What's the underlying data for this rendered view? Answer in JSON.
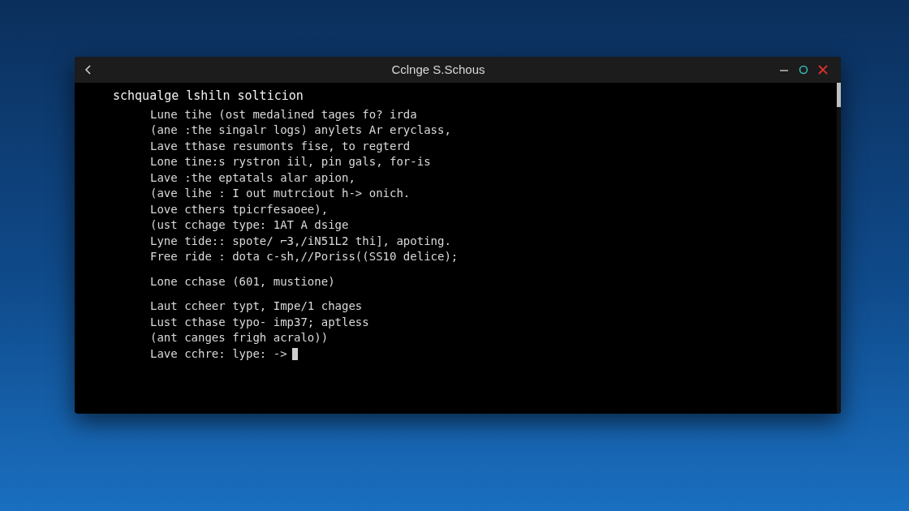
{
  "window": {
    "title": "Cclnge S.Schous"
  },
  "terminal": {
    "heading": "schqualge lshiln solticion",
    "blocks": [
      [
        "Lune tihe (ost medalined tages fo? irda",
        "(ane :the singalr logs) anylets Ar eryclass,",
        "Lave tthase resumonts fise, to regterd",
        "Lone tine:s rystron iil, pin gals, for-is",
        "Lave :the eptatals alar apion,",
        "(ave lihe : I out mutrciout h-> onich.",
        "Love cthers tpicrfesaoee),",
        "(ust cchage type: 1AT A dsige",
        "Lyne tide:: spote/ ⌐3,/iN51L2 thi], apoting.",
        "Free ride : dota c-sh,//Poriss((SS10 delice);"
      ],
      [
        "Lone cchase (601, mustione)"
      ],
      [
        "Laut ccheer typt, Impe/1 chages",
        "Lust cthase typo- imp37; aptless",
        "(ant canges frigh acralo))"
      ]
    ],
    "prompt": "Lave cchre: lype: ->"
  }
}
